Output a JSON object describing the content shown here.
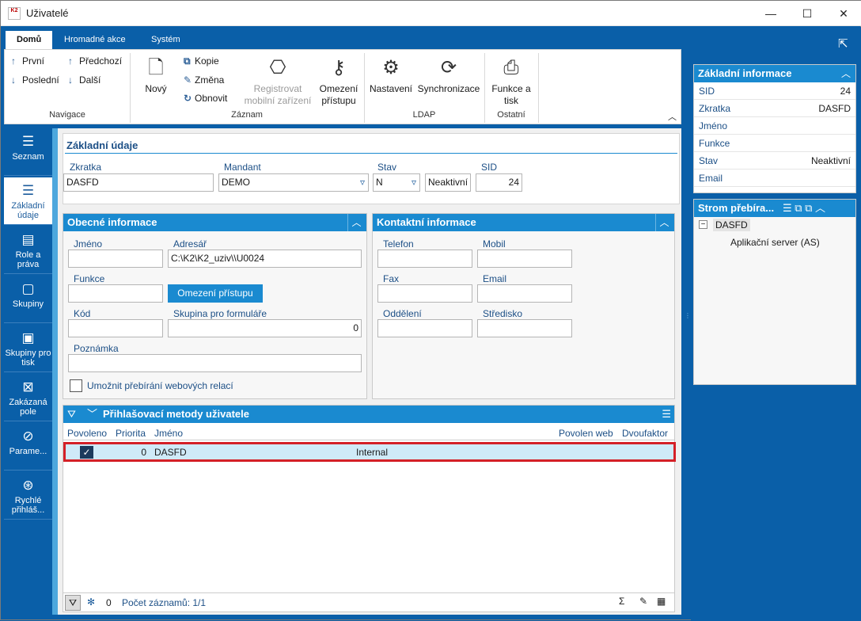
{
  "window": {
    "title": "Uživatelé",
    "logo_text": "K2",
    "minimize": "—",
    "maximize": "☐",
    "close": "✕"
  },
  "ribbon_tabs": [
    {
      "label": "Domů"
    },
    {
      "label": "Hromadné akce"
    },
    {
      "label": "Systém"
    }
  ],
  "ribbon": {
    "nav": {
      "first": "První",
      "prev": "Předchozí",
      "last": "Poslední",
      "next": "Další",
      "group": "Navigace"
    },
    "record": {
      "new": "Nový",
      "copy": "Kopie",
      "change": "Změna",
      "refresh": "Obnovit",
      "register": "Registrovat mobilní zařízení",
      "restrict": "Omezení přístupu",
      "group": "Záznam"
    },
    "ldap": {
      "settings": "Nastavení",
      "sync": "Synchronizace",
      "group": "LDAP"
    },
    "other": {
      "print": "Funkce a tisk",
      "group": "Ostatní"
    }
  },
  "leftnav": [
    {
      "label": "Seznam"
    },
    {
      "label": "Základní údaje"
    },
    {
      "label": "Role a práva"
    },
    {
      "label": "Skupiny"
    },
    {
      "label": "Skupiny pro tisk"
    },
    {
      "label": "Zakázaná pole"
    },
    {
      "label": "Parame..."
    },
    {
      "label": "Rychlé přihláš..."
    }
  ],
  "basic": {
    "title": "Základní údaje",
    "zkratka_label": "Zkratka",
    "zkratka": "DASFD",
    "mandant_label": "Mandant",
    "mandant": "DEMO",
    "stav_label": "Stav",
    "stav": "N",
    "stav_text": "Neaktivní",
    "sid_label": "SID",
    "sid": "24"
  },
  "general": {
    "title": "Obecné informace",
    "jmeno_label": "Jméno",
    "jmeno": "",
    "adresar_label": "Adresář",
    "adresar": "C:\\K2\\K2_uziv\\\\U0024",
    "funkce_label": "Funkce",
    "funkce": "",
    "restrict_btn": "Omezení přístupu",
    "kod_label": "Kód",
    "kod": "",
    "skupina_label": "Skupina pro formuláře",
    "skupina": "0",
    "poznamka_label": "Poznámka",
    "poznamka": "",
    "web_label": "Umožnit přebírání webových relací"
  },
  "contact": {
    "title": "Kontaktní informace",
    "telefon_label": "Telefon",
    "mobil_label": "Mobil",
    "fax_label": "Fax",
    "email_label": "Email",
    "oddeleni_label": "Oddělení",
    "stredisko_label": "Středisko"
  },
  "login_methods": {
    "title": "Přihlašovací metody uživatele",
    "columns": [
      "Povoleno",
      "Priorita",
      "Jméno",
      "",
      "Povolen web",
      "Dvoufaktor"
    ],
    "rows": [
      {
        "enabled": true,
        "priority": "0",
        "name": "DASFD",
        "type": "Internal",
        "web": "",
        "twofactor": ""
      }
    ]
  },
  "footer": {
    "snow_count": "0",
    "records": "Počet záznamů: 1/1"
  },
  "right": {
    "info_title": "Základní informace",
    "rows": [
      {
        "k": "SID",
        "v": "24"
      },
      {
        "k": "Zkratka",
        "v": "DASFD"
      },
      {
        "k": "Jméno",
        "v": ""
      },
      {
        "k": "Funkce",
        "v": ""
      },
      {
        "k": "Stav",
        "v": "Neaktivní"
      },
      {
        "k": "Email",
        "v": ""
      }
    ],
    "tree_title": "Strom přebíra...",
    "tree_root": "DASFD",
    "tree_child": "Aplikační server (AS)"
  },
  "colors": {
    "brand": "#0a5fa8",
    "accent": "#1a8ad0",
    "highlight": "#d42027"
  }
}
